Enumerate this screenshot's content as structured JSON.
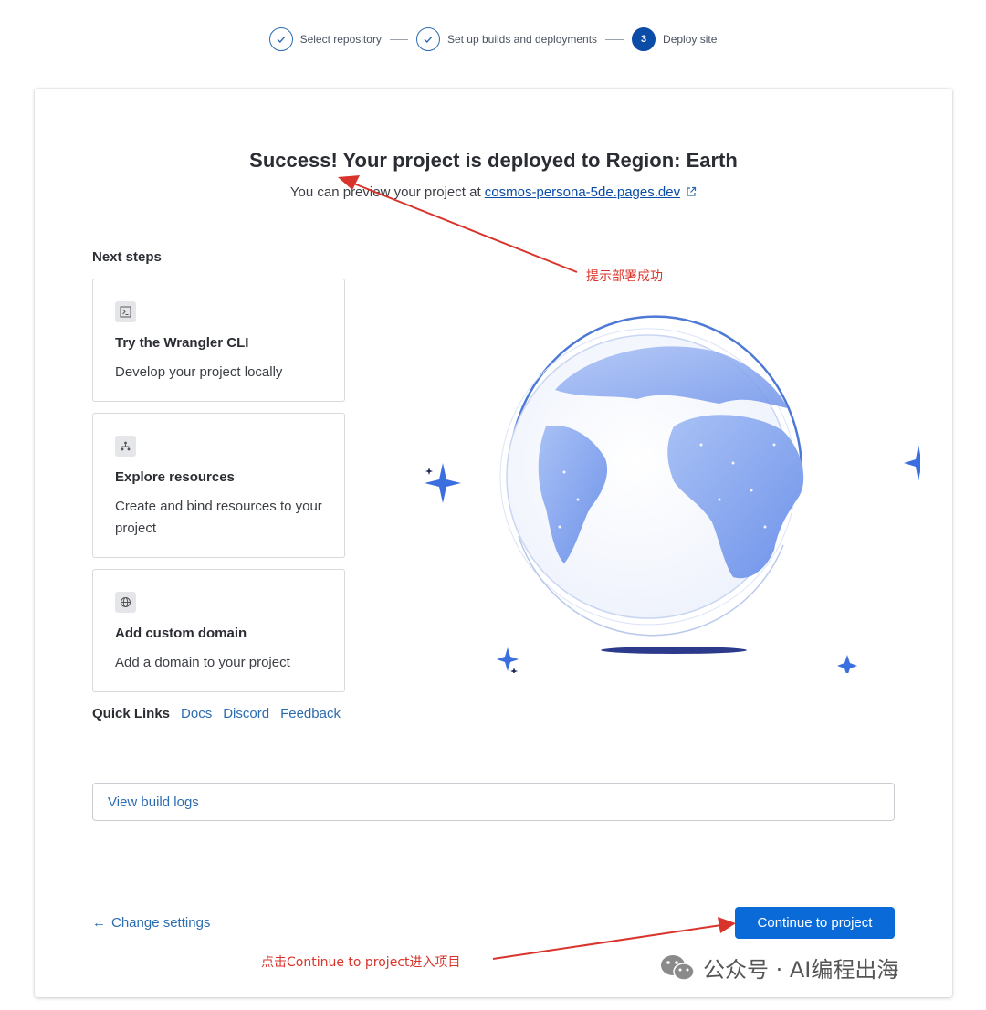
{
  "stepper": {
    "steps": [
      {
        "label": "Select repository",
        "state": "done"
      },
      {
        "label": "Set up builds and deployments",
        "state": "done"
      },
      {
        "label": "Deploy site",
        "state": "active",
        "number": "3"
      }
    ]
  },
  "main": {
    "title": "Success! Your project is deployed to Region: Earth",
    "subtitle_prefix": "You can preview your project at",
    "preview_link": "cosmos-persona-5de.pages.dev",
    "next_steps_title": "Next steps",
    "next_steps": [
      {
        "icon": "terminal-icon",
        "title": "Try the Wrangler CLI",
        "description": "Develop your project locally"
      },
      {
        "icon": "resources-icon",
        "title": "Explore resources",
        "description": "Create and bind resources to your project"
      },
      {
        "icon": "globe-icon",
        "title": "Add custom domain",
        "description": "Add a domain to your project"
      }
    ],
    "quick_links_label": "Quick Links",
    "quick_links": [
      "Docs",
      "Discord",
      "Feedback"
    ],
    "build_logs_label": "View build logs",
    "change_settings_label": "Change settings",
    "continue_label": "Continue to project"
  },
  "annotations": {
    "deploy_success": "提示部署成功",
    "click_continue": "点击Continue to project进入项目"
  },
  "watermark": {
    "text": "公众号 · AI编程出海"
  },
  "colors": {
    "accent": "#0a6bd8",
    "link": "#2b6cb0",
    "stepper_active": "#0a4ca6",
    "annotation": "#d9342b"
  }
}
